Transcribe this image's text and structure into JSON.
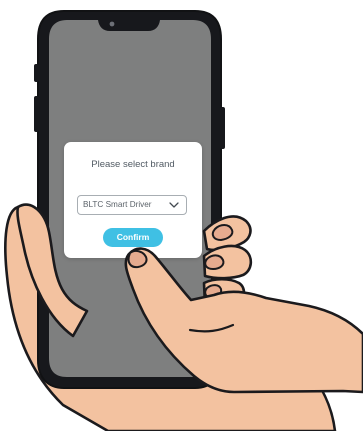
{
  "dialog": {
    "title": "Please select brand",
    "select": {
      "value": "BLTC Smart Driver",
      "icon": "chevron-down-icon"
    },
    "confirm_label": "Confirm"
  },
  "colors": {
    "phone_body": "#17181c",
    "screen": "#7e7f7f",
    "skin": "#f3c2a0",
    "skin_shadow": "#df9f82",
    "outline": "#1b1a1d",
    "accent": "#3fc0e4"
  }
}
